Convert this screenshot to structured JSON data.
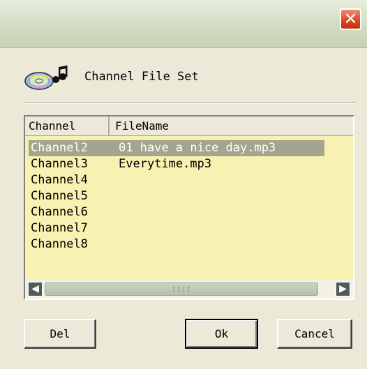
{
  "window": {
    "close_label": "✕"
  },
  "header": {
    "title": "Channel File Set",
    "icon": "cd-music-icon"
  },
  "listview": {
    "columns": [
      "Channel",
      "FileName"
    ],
    "rows": [
      {
        "channel": "Channel2",
        "file": "01 have a nice day.mp3",
        "selected": true
      },
      {
        "channel": "Channel3",
        "file": "Everytime.mp3",
        "selected": false
      },
      {
        "channel": "Channel4",
        "file": "",
        "selected": false
      },
      {
        "channel": "Channel5",
        "file": "",
        "selected": false
      },
      {
        "channel": "Channel6",
        "file": "",
        "selected": false
      },
      {
        "channel": "Channel7",
        "file": "",
        "selected": false
      },
      {
        "channel": "Channel8",
        "file": "",
        "selected": false
      }
    ],
    "scroll_left": "◀",
    "scroll_right": "▶",
    "grip": "IIII"
  },
  "buttons": {
    "del": "Del",
    "ok": "Ok",
    "cancel": "Cancel"
  },
  "colors": {
    "list_bg": "#f7f2b1",
    "selected_row": "#a4a58f",
    "close_button": "#d9461f"
  }
}
